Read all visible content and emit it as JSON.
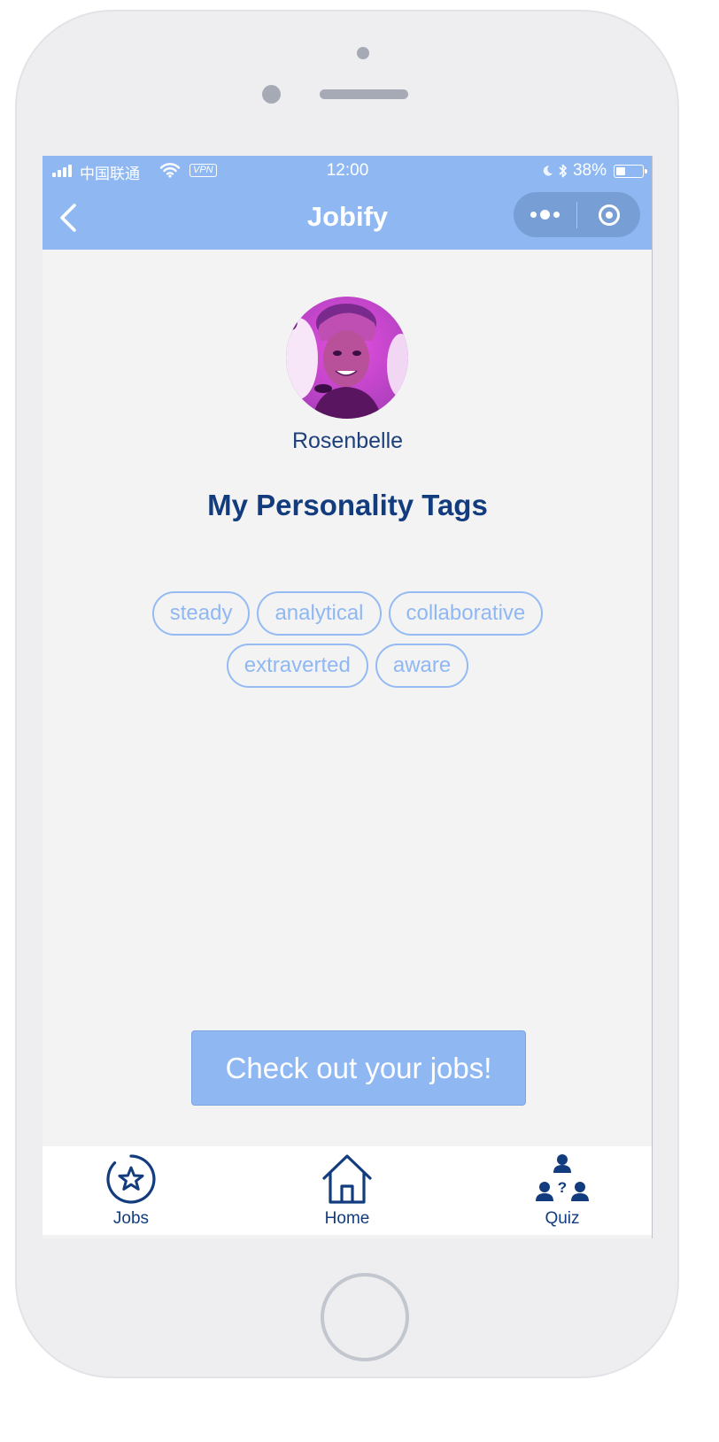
{
  "status_bar": {
    "carrier": "中国联通",
    "vpn": "VPN",
    "time": "12:00",
    "battery": "38%",
    "battery_level": 0.38
  },
  "nav": {
    "title": "Jobify"
  },
  "profile": {
    "username": "Rosenbelle"
  },
  "tags_title": "My Personality Tags",
  "tags": [
    "steady",
    "analytical",
    "collaborative",
    "extraverted",
    "aware"
  ],
  "cta_label": "Check out your jobs!",
  "tab_bar": {
    "items": [
      {
        "label": "Jobs",
        "icon": "star-circle-icon"
      },
      {
        "label": "Home",
        "icon": "house-icon"
      },
      {
        "label": "Quiz",
        "icon": "people-question-icon"
      }
    ]
  },
  "colors": {
    "primary": "#8fb8f3",
    "dark_blue": "#123c7d",
    "background": "#f3f3f4"
  }
}
